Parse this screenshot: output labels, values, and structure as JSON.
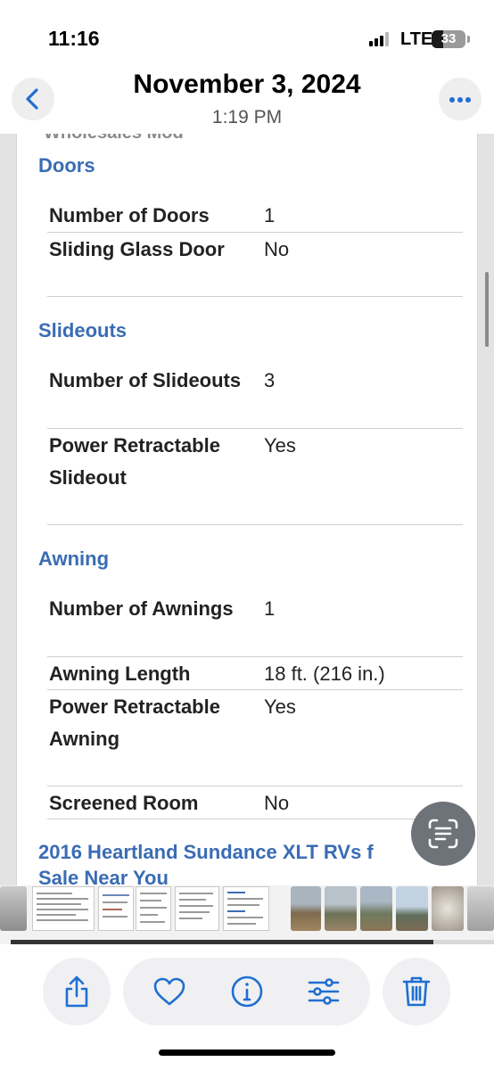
{
  "status_bar": {
    "time": "11:16",
    "network": "LTE",
    "battery_level": "33",
    "battery_fraction": 0.33,
    "signal_bars_filled": 3,
    "signal_bars_total": 4
  },
  "header": {
    "title": "November 3, 2024",
    "subtitle": "1:19 PM",
    "back_icon": "chevron-left-icon",
    "more_icon": "ellipsis-icon"
  },
  "document": {
    "cut_off_text": "Wholesales Mod",
    "sections": [
      {
        "heading": "Doors",
        "rows": [
          {
            "label": "Number of Doors",
            "value": "1"
          },
          {
            "label": "Sliding Glass Door",
            "value": "No"
          }
        ]
      },
      {
        "heading": "Slideouts",
        "rows": [
          {
            "label": "Number of Slideouts",
            "value": "3"
          },
          {
            "label": "Power Retractable Slideout",
            "value": "Yes"
          }
        ]
      },
      {
        "heading": "Awning",
        "rows": [
          {
            "label": "Number of Awnings",
            "value": "1"
          },
          {
            "label": "Awning Length",
            "value": "18 ft. (216 in.)"
          },
          {
            "label": "Power Retractable Awning",
            "value": "Yes"
          },
          {
            "label": "Screened Room",
            "value": "No"
          }
        ]
      }
    ],
    "footer_heading_line1": "2016 Heartland Sundance XLT RVs f",
    "footer_heading_line2": "Sale Near You"
  },
  "live_text_icon": "live-text-scan-icon",
  "toolbar": {
    "share_icon": "share-icon",
    "favorite_icon": "heart-icon",
    "info_icon": "info-icon",
    "adjust_icon": "sliders-icon",
    "delete_icon": "trash-icon"
  },
  "colors": {
    "accent": "#1a73e8",
    "ios_blue": "#1f6fd1",
    "section_heading": "#3a6cb4",
    "button_bg": "#f0f0f2"
  }
}
